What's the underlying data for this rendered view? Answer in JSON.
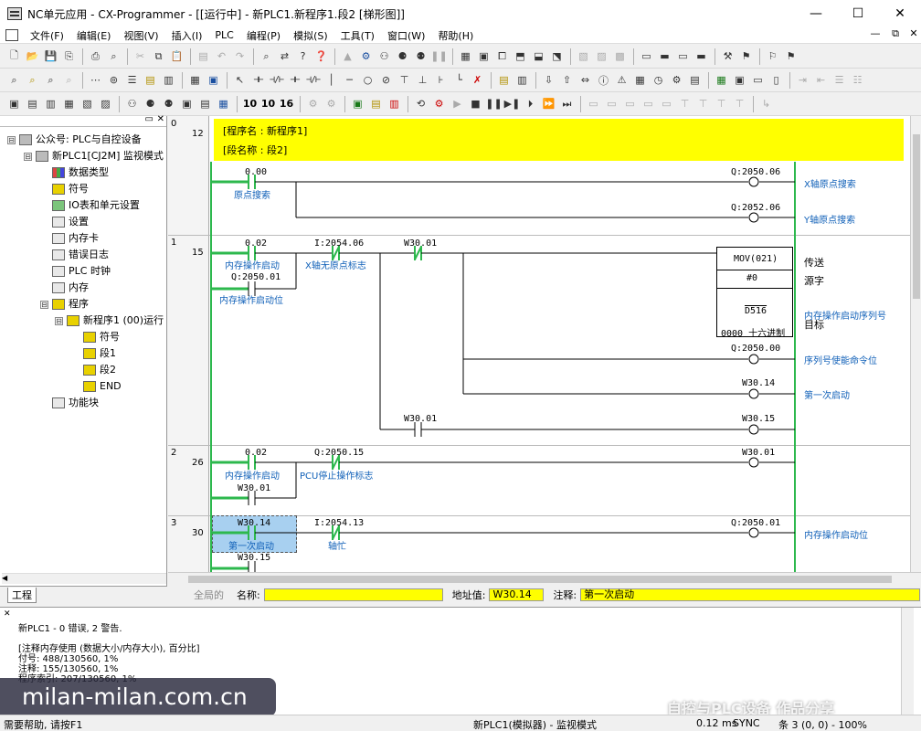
{
  "window": {
    "title": "NC单元应用 - CX-Programmer - [[运行中] - 新PLC1.新程序1.段2 [梯形图]]"
  },
  "menu": [
    "文件(F)",
    "编辑(E)",
    "视图(V)",
    "插入(I)",
    "PLC",
    "编程(P)",
    "模拟(S)",
    "工具(T)",
    "窗口(W)",
    "帮助(H)"
  ],
  "tree": {
    "items": [
      {
        "label": "公众号: PLC与自控设备",
        "exp": "⊟"
      },
      {
        "label": "新PLC1[CJ2M] 监视模式",
        "exp": "⊟"
      },
      {
        "label": "数据类型",
        "exp": ""
      },
      {
        "label": "符号",
        "exp": ""
      },
      {
        "label": "IO表和单元设置",
        "exp": ""
      },
      {
        "label": "设置",
        "exp": ""
      },
      {
        "label": "内存卡",
        "exp": ""
      },
      {
        "label": "错误日志",
        "exp": ""
      },
      {
        "label": "PLC 时钟",
        "exp": ""
      },
      {
        "label": "内存",
        "exp": ""
      },
      {
        "label": "程序",
        "exp": "⊟"
      },
      {
        "label": "新程序1 (00)运行",
        "exp": "⊟"
      },
      {
        "label": "符号",
        "exp": ""
      },
      {
        "label": "段1",
        "exp": ""
      },
      {
        "label": "段2",
        "exp": ""
      },
      {
        "label": "END",
        "exp": ""
      },
      {
        "label": "功能块",
        "exp": ""
      }
    ],
    "tab_label": "工程"
  },
  "ladder": {
    "header": {
      "program_name": "[程序名 : 新程序1]",
      "section_name": "[段名称 : 段2]"
    },
    "rungs": [
      {
        "rung": "0",
        "step": "12"
      },
      {
        "rung": "1",
        "step": "15"
      },
      {
        "rung": "2",
        "step": "26"
      },
      {
        "rung": "3",
        "step": "30"
      }
    ],
    "labels": {
      "r0_c1_addr": "0.00",
      "r0_c1_cmt": "原点搜索",
      "r0_o1_addr": "Q:2050.06",
      "r0_o1_cmt": "X轴原点搜索",
      "r0_o2_addr": "Q:2052.06",
      "r0_o2_cmt": "Y轴原点搜索",
      "r1_c1_addr": "0.02",
      "r1_c1_cmt": "内存操作启动",
      "r1_c2_addr": "I:2054.06",
      "r1_c2_cmt": "X轴无原点标志",
      "r1_c3_addr": "W30.01",
      "r1_c4_addr": "Q:2050.01",
      "r1_c4_cmt": "内存操作启动位",
      "fb_name": "MOV(021)",
      "fb_op1": "#0",
      "fb_op2": "D516",
      "fb_foot": "0000 十六进制",
      "fb_side1": "传送",
      "fb_side2": "源字",
      "fb_side3": "内存操作启动序列号",
      "fb_side4": "目标",
      "r1_o1_addr": "Q:2050.00",
      "r1_o1_cmt": "序列号使能命令位",
      "r1_o2_addr": "W30.14",
      "r1_o2_cmt": "第一次启动",
      "r1_c5_addr": "W30.01",
      "r1_o3_addr": "W30.15",
      "r2_c1_addr": "0.02",
      "r2_c1_cmt": "内存操作启动",
      "r2_c2_addr": "Q:2050.15",
      "r2_c2_cmt": "PCU停止操作标志",
      "r2_c3_addr": "W30.01",
      "r2_o1_addr": "W30.01",
      "r3_c1_addr": "W30.14",
      "r3_c1_cmt": "第一次启动",
      "r3_c2_addr": "I:2054.13",
      "r3_c2_cmt": "轴忙",
      "r3_c3_addr": "W30.15",
      "r3_o1_addr": "Q:2050.01",
      "r3_o1_cmt": "内存操作启动位"
    }
  },
  "infobar": {
    "global_label": "全局的",
    "name_label": "名称:",
    "name_value": "",
    "address_label": "地址值:",
    "address_value": "W30.14",
    "comment_label": "注释:",
    "comment_value": "第一次启动"
  },
  "output": {
    "lines": [
      "新PLC1 - 0 错误, 2 警告.",
      "[注释内存使用 (数据大小/内存大小), 百分比]",
      "付号: 488/130560, 1%",
      "注释: 155/130560, 1%",
      "程序索引: 207/130560, 1%"
    ]
  },
  "watermark": {
    "left": "milan-milan.com.cn",
    "right": "自控与PLC设备 作品分享"
  },
  "status": {
    "help": "需要帮助, 请按F1",
    "mode": "新PLC1(模拟器) - 监视模式",
    "cycle": "0.12 ms",
    "sync": "SYNC",
    "position": "条 3 (0, 0) - 100%"
  }
}
